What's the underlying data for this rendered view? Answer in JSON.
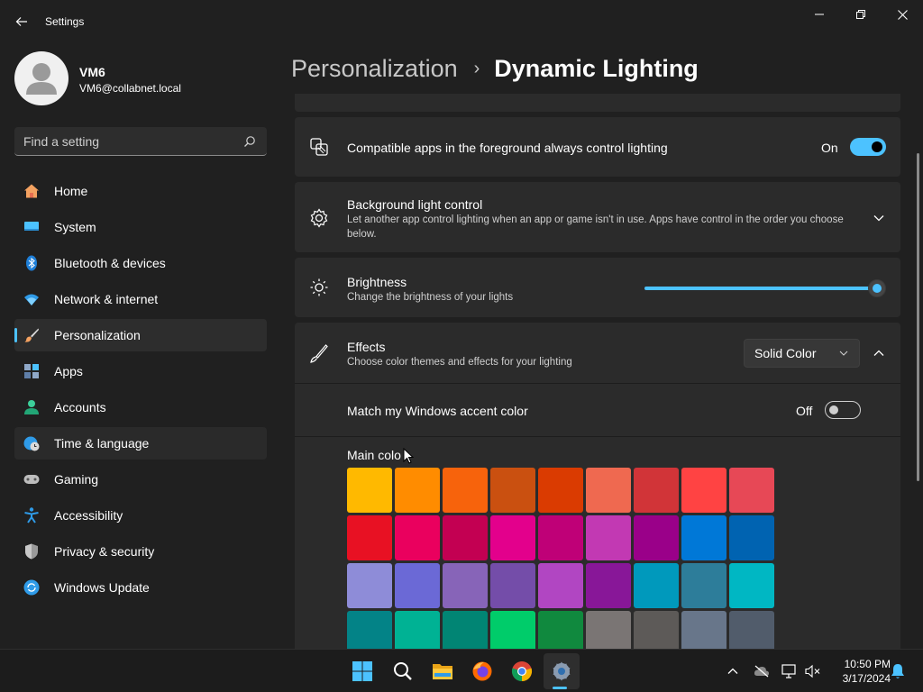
{
  "window": {
    "title": "Settings"
  },
  "profile": {
    "name": "VM6",
    "email": "VM6@collabnet.local"
  },
  "search": {
    "placeholder": "Find a setting"
  },
  "nav": {
    "items": [
      {
        "label": "Home",
        "icon": "home-icon"
      },
      {
        "label": "System",
        "icon": "system-icon"
      },
      {
        "label": "Bluetooth & devices",
        "icon": "bluetooth-icon"
      },
      {
        "label": "Network & internet",
        "icon": "wifi-icon"
      },
      {
        "label": "Personalization",
        "icon": "brush-icon",
        "selected": true
      },
      {
        "label": "Apps",
        "icon": "apps-icon"
      },
      {
        "label": "Accounts",
        "icon": "accounts-icon"
      },
      {
        "label": "Time & language",
        "icon": "globe-clock-icon"
      },
      {
        "label": "Gaming",
        "icon": "gamepad-icon"
      },
      {
        "label": "Accessibility",
        "icon": "accessibility-icon"
      },
      {
        "label": "Privacy & security",
        "icon": "shield-icon"
      },
      {
        "label": "Windows Update",
        "icon": "update-icon"
      }
    ]
  },
  "breadcrumb": {
    "parent": "Personalization",
    "separator": "›",
    "current": "Dynamic Lighting"
  },
  "settings": {
    "foreground": {
      "title": "Compatible apps in the foreground always control lighting",
      "state_label": "On",
      "on": true
    },
    "background": {
      "title": "Background light control",
      "desc": "Let another app control lighting when an app or game isn't in use. Apps have control in the order you choose below."
    },
    "brightness": {
      "title": "Brightness",
      "desc": "Change the brightness of your lights",
      "value_percent": 100
    },
    "effects": {
      "title": "Effects",
      "desc": "Choose color themes and effects for your lighting",
      "selected": "Solid Color"
    },
    "match_accent": {
      "title": "Match my Windows accent color",
      "state_label": "Off",
      "on": false
    },
    "main_color": {
      "label": "Main colo",
      "swatches": [
        "#ffb900",
        "#ff8c00",
        "#f7630c",
        "#ca5010",
        "#da3b01",
        "#ef6950",
        "#d13438",
        "#ff4343",
        "#e74856",
        "#e81123",
        "#ea005e",
        "#c30052",
        "#e3008c",
        "#bf0077",
        "#c239b3",
        "#9a0089",
        "#0078d7",
        "#0063b1",
        "#8e8cd8",
        "#6b69d6",
        "#8764b8",
        "#744da9",
        "#b146c2",
        "#881798",
        "#0099bc",
        "#2d7d9a",
        "#00b7c3",
        "#038387",
        "#00b294",
        "#018574",
        "#00cc6a",
        "#10893e",
        "#7a7574",
        "#5d5a58",
        "#68768a",
        "#515c6b"
      ]
    }
  },
  "taskbar": {
    "apps": [
      "windows-start-icon",
      "search-icon",
      "file-explorer-icon",
      "firefox-icon",
      "chrome-icon",
      "settings-icon"
    ],
    "time": "10:50 PM",
    "date": "3/17/2024"
  },
  "colors": {
    "accent": "#4cc2ff",
    "background": "#202020",
    "card": "#2b2b2b"
  }
}
